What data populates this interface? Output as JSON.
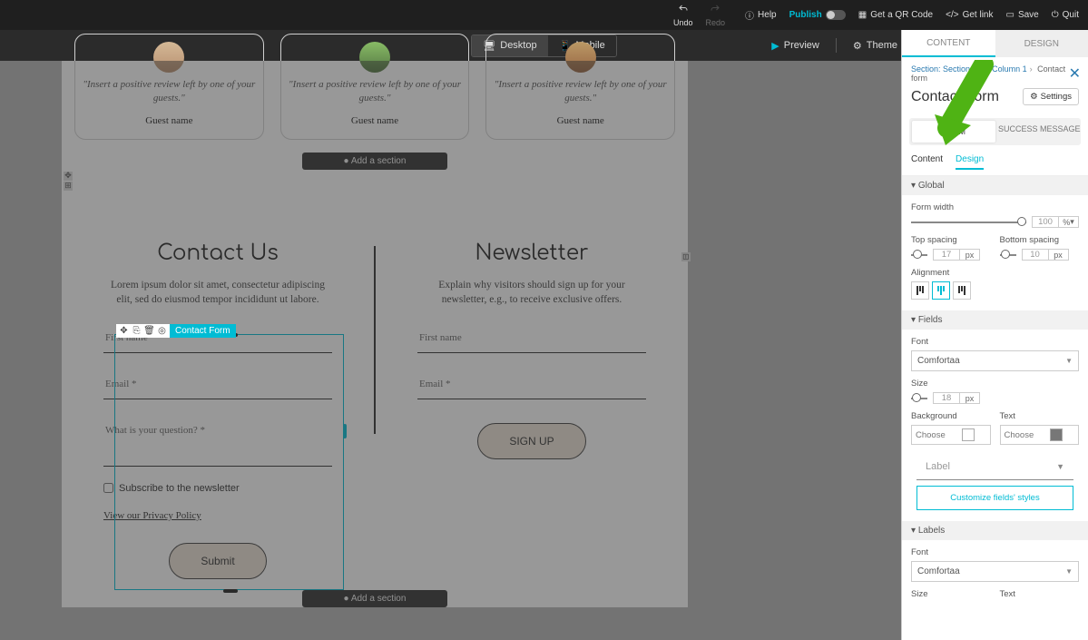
{
  "topbar": {
    "undo": "Undo",
    "redo": "Redo",
    "help": "Help",
    "publish": "Publish",
    "qr": "Get a QR Code",
    "link": "Get link",
    "save": "Save",
    "quit": "Quit"
  },
  "secbar": {
    "desktop": "Desktop",
    "mobile": "Mobile",
    "preview": "Preview",
    "theme": "Theme"
  },
  "testimonials": {
    "quote": "\"Insert a positive review left by one of your guests.\"",
    "guest": "Guest name"
  },
  "addsection": "Add a section",
  "contact": {
    "title": "Contact Us",
    "desc": "Lorem ipsum dolor sit amet, consectetur adipiscing elit, sed do eiusmod tempor incididunt ut labore.",
    "first_name": "First name",
    "email": "Email *",
    "question": "What is your question? *",
    "subscribe": "Subscribe to the newsletter",
    "policy": "View our Privacy Policy",
    "submit": "Submit"
  },
  "newsletter": {
    "title": "Newsletter",
    "desc": "Explain why visitors should sign up for your newsletter, e.g., to receive exclusive offers.",
    "first_name": "First name",
    "email": "Email *",
    "signup": "SIGN UP"
  },
  "selection": {
    "label": "Contact Form"
  },
  "panel": {
    "tab_content": "CONTENT",
    "tab_design": "DESIGN",
    "crumb_section": "Section: Section 13",
    "crumb_column": "Column 1",
    "crumb_current": "Contact form",
    "heading": "Contact Form",
    "settings": "Settings",
    "form_tab": "FORM",
    "success_tab": "SUCCESS MESSAGE",
    "sub_content": "Content",
    "sub_design": "Design",
    "sec_global": "Global",
    "form_width": "Form width",
    "form_width_val": "100",
    "form_width_unit": "%",
    "top_spacing": "Top spacing",
    "top_spacing_val": "17",
    "bottom_spacing": "Bottom spacing",
    "bottom_spacing_val": "10",
    "px": "px",
    "alignment": "Alignment",
    "sec_fields": "Fields",
    "font": "Font",
    "font_val": "Comfortaa",
    "size": "Size",
    "size_val": "18",
    "background": "Background",
    "text": "Text",
    "choose": "Choose",
    "label_preview": "Label",
    "customize": "Customize fields' styles",
    "sec_labels": "Labels"
  }
}
